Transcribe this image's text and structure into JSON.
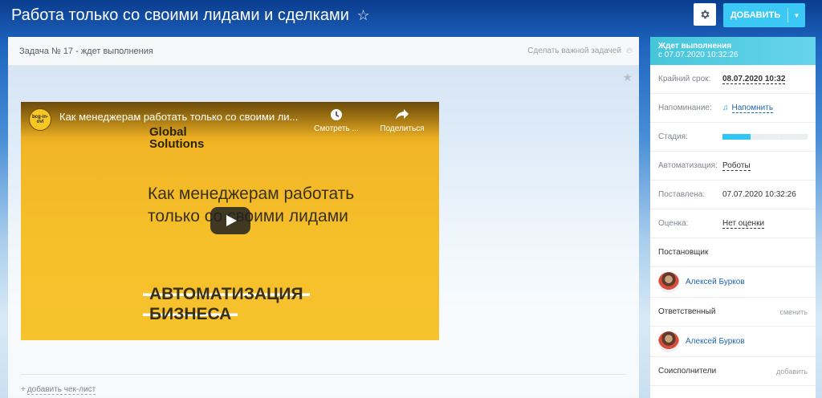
{
  "header": {
    "title": "Работа только со своими лидами и сделками",
    "star_glyph": "☆",
    "add_button_label": "добавить"
  },
  "task": {
    "header_label": "Задача № 17 - ждет выполнения",
    "important_link": "Сделать важной задачей"
  },
  "video": {
    "channel_logo": "bcg-in-ovl",
    "title": "Как менеджерам работать только со своими ли...",
    "watch_later": "Смотреть ...",
    "share": "Поделиться",
    "company": "Global Solutions",
    "heading": "Как менеджерам работать только со своими лидами",
    "tag1": "АВТОМАТИЗАЦИЯ",
    "tag2": "БИЗНЕСА"
  },
  "checklist": {
    "label": "добавить чек-лист"
  },
  "sidebar": {
    "status_state": "Ждет выполнения",
    "status_since": "с 07.07.2020 10:32:26",
    "deadline_label": "Крайний срок:",
    "deadline_value": "08.07.2020 10:32",
    "reminder_label": "Напоминание:",
    "reminder_value": "Напомнить",
    "stage_label": "Стадия:",
    "stage_progress": 0.33,
    "automation_label": "Автоматизация:",
    "automation_value": "Роботы",
    "created_label": "Поставлена:",
    "created_value": "07.07.2020 10:32:26",
    "rating_label": "Оценка:",
    "rating_value": "Нет оценки",
    "creator_head": "Постановщик",
    "creator_name": "Алексей Бурков",
    "responsible_head": "Ответственный",
    "responsible_action": "сменить",
    "responsible_name": "Алексей Бурков",
    "accomplices_head": "Соисполнители",
    "accomplices_action": "добавить"
  },
  "colors": {
    "accent": "#3bc8f5",
    "link": "#2067b0",
    "status_header": "#55d0e0",
    "video_bg": "#f5c02a"
  }
}
